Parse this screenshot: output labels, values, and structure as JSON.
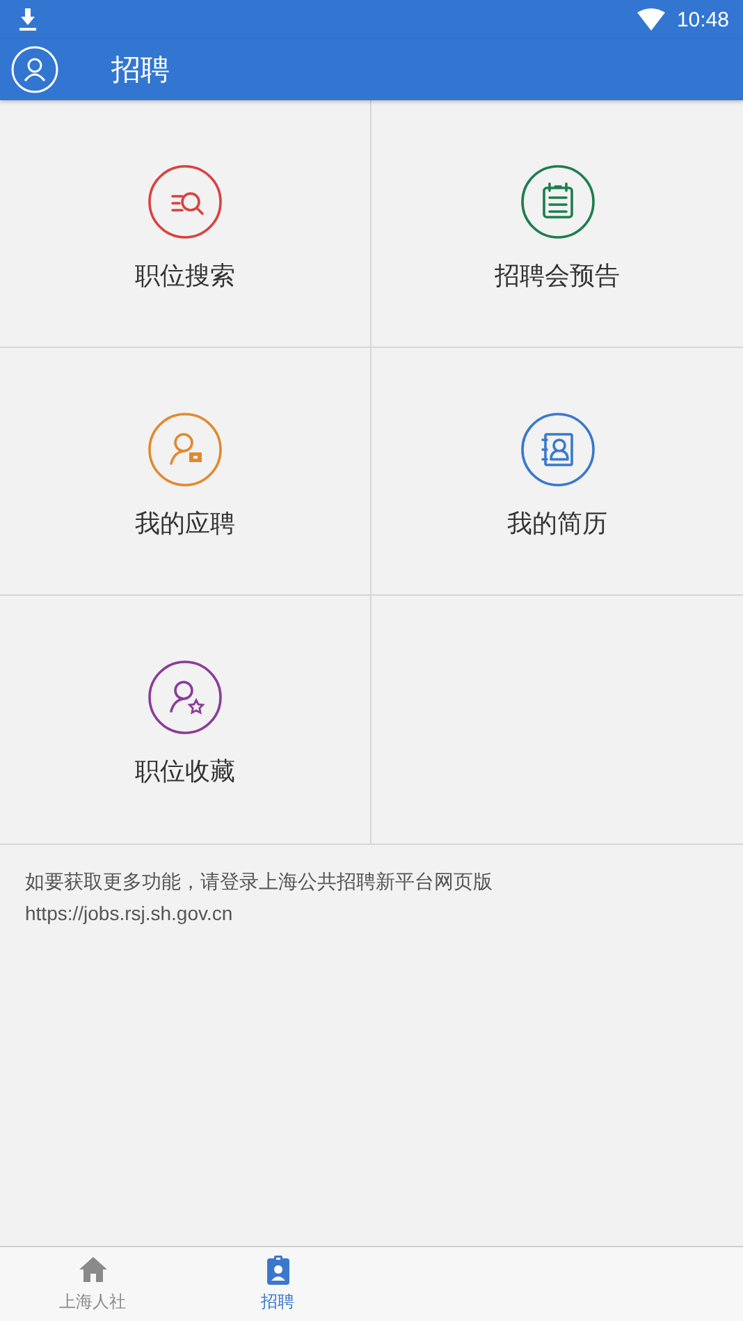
{
  "status_bar": {
    "time": "10:48"
  },
  "app_bar": {
    "title": "招聘"
  },
  "tiles": [
    {
      "label": "职位搜索",
      "kind": "search",
      "color": "#d9423f"
    },
    {
      "label": "招聘会预告",
      "kind": "calendar",
      "color": "#1e7d4e"
    },
    {
      "label": "我的应聘",
      "kind": "applicant",
      "color": "#e08a2e"
    },
    {
      "label": "我的简历",
      "kind": "resume",
      "color": "#3a78cc"
    },
    {
      "label": "职位收藏",
      "kind": "favorite",
      "color": "#8a3d98"
    }
  ],
  "notice": {
    "text": "如要获取更多功能，请登录上海公共招聘新平台网页版",
    "link": "https://jobs.rsj.sh.gov.cn"
  },
  "bottom_nav": [
    {
      "label": "上海人社",
      "kind": "home",
      "selected": false
    },
    {
      "label": "招聘",
      "kind": "badge",
      "selected": true
    }
  ]
}
